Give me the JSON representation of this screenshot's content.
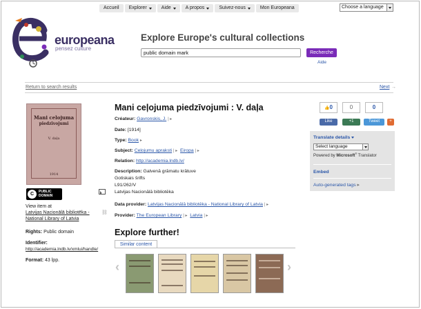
{
  "nav": {
    "items": [
      {
        "label": "Accueil",
        "caret": false
      },
      {
        "label": "Explorer",
        "caret": true
      },
      {
        "label": "Aide",
        "caret": true
      },
      {
        "label": "A propos",
        "caret": true
      },
      {
        "label": "Suivez-nous",
        "caret": true
      },
      {
        "label": "Mon Europeana",
        "caret": false
      }
    ],
    "language_select": "Choose a language"
  },
  "logo": {
    "word": "europeana",
    "tagline": "pensez culture"
  },
  "header": {
    "title": "Explore Europe's cultural collections",
    "search_value": "public domain mark",
    "search_button": "Recherche",
    "search_help": "Aide"
  },
  "navigation": {
    "back": "Return to search results",
    "next": "Next",
    "next_arrow": "→"
  },
  "cover": {
    "lines": [
      "Mani celojuma",
      "piedzīvojumi",
      "V. daļa",
      "1914"
    ]
  },
  "left": {
    "license_badge_top": "PUBLIC",
    "license_badge_bottom": "DOMAIN",
    "view_item_at": "View item at",
    "provider_link": "Latvijas Nacionālā bibliotēka - National Library of Latvia",
    "rights_label": "Rights:",
    "rights_value": "Public domain",
    "identifier_label": "Identifier:",
    "identifier_value": "http://academia.lndb.lv/xmlui/handle/",
    "format_label": "Format:",
    "format_value": "43 lpp."
  },
  "record": {
    "title": "Mani ceļojuma piedzīvojumi : V. daļa",
    "creator_label": "Créateur:",
    "creator": "Gavronskis, J.",
    "date_label": "Date:",
    "date": "[1914]",
    "type_label": "Type:",
    "type": "Book",
    "subject_label": "Subject:",
    "subject_1": "Ceļojumu apraksti",
    "subject_2": "Eiropa",
    "relation_label": "Relation:",
    "relation": "http://academia.lndb.lv/",
    "description_label": "Description:",
    "description_lines": [
      "Galvenā grāmatu krātuve",
      "Gotiskais šrifts",
      "L91/262/V",
      "Latvijas Nacionālā bibliotēka"
    ],
    "data_provider_label": "Data provider:",
    "data_provider": "Latvijas Nacionālā bibliotēka - National Library of Latvia",
    "provider_label": "Provider:",
    "provider_1": "The European Library",
    "provider_2": "Latvia"
  },
  "explore": {
    "title": "Explore further!",
    "tab": "Similar content"
  },
  "social": {
    "like_count": "0",
    "plusone_count": "0",
    "tweet_count": "0",
    "like": "Like",
    "plusone": "+1",
    "tweet": "Tweet",
    "share": "+"
  },
  "side_panel": {
    "translate": "Translate details",
    "select_language": "Select language",
    "powered_by": "Powered by",
    "microsoft": "Microsoft",
    "translator": "Translator",
    "embed": "Embed",
    "auto_tags": "Auto-generated tags"
  },
  "colors": {
    "accent": "#7a2bb8",
    "link": "#2a56a8",
    "panel": "#e4e4e4"
  }
}
